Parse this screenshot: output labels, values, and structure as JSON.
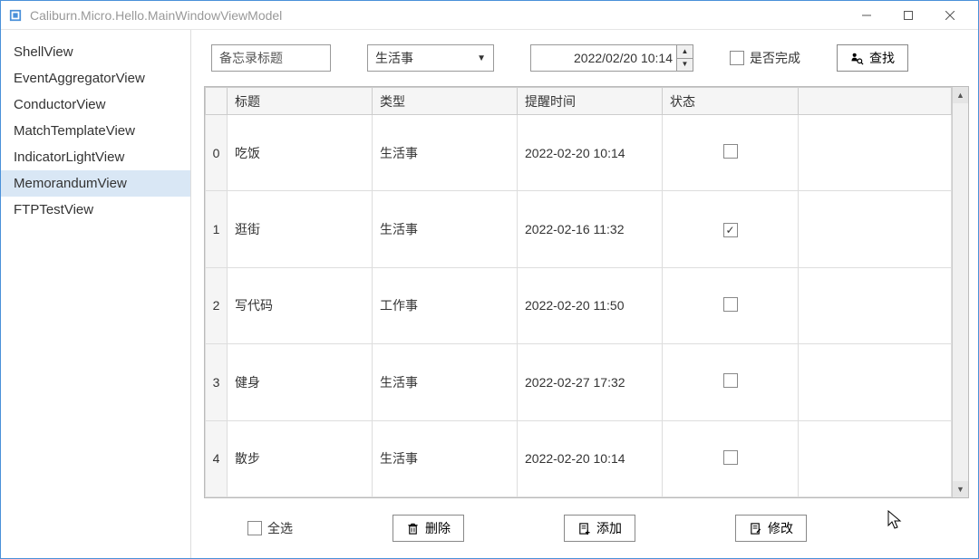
{
  "window": {
    "title": "Caliburn.Micro.Hello.MainWindowViewModel"
  },
  "sidebar": {
    "items": [
      {
        "label": "ShellView",
        "active": false
      },
      {
        "label": "EventAggregatorView",
        "active": false
      },
      {
        "label": "ConductorView",
        "active": false
      },
      {
        "label": "MatchTemplateView",
        "active": false
      },
      {
        "label": "IndicatorLightView",
        "active": false
      },
      {
        "label": "MemorandumView",
        "active": true
      },
      {
        "label": "FTPTestView",
        "active": false
      }
    ]
  },
  "toolbar": {
    "title_input_value": "备忘录标题",
    "type_combo_value": "生活事",
    "datetime_value": "2022/02/20 10:14",
    "done_checkbox_label": "是否完成",
    "search_button_label": "查找"
  },
  "grid": {
    "columns": [
      "标题",
      "类型",
      "提醒时间",
      "状态"
    ],
    "rows": [
      {
        "index": 0,
        "title": "吃饭",
        "type": "生活事",
        "time": "2022-02-20 10:14",
        "status": false
      },
      {
        "index": 1,
        "title": "逛街",
        "type": "生活事",
        "time": "2022-02-16 11:32",
        "status": true
      },
      {
        "index": 2,
        "title": "写代码",
        "type": "工作事",
        "time": "2022-02-20 11:50",
        "status": false
      },
      {
        "index": 3,
        "title": "健身",
        "type": "生活事",
        "time": "2022-02-27 17:32",
        "status": false
      },
      {
        "index": 4,
        "title": "散步",
        "type": "生活事",
        "time": "2022-02-20 10:14",
        "status": false
      }
    ]
  },
  "bottombar": {
    "select_all_label": "全选",
    "delete_label": "删除",
    "add_label": "添加",
    "modify_label": "修改"
  }
}
